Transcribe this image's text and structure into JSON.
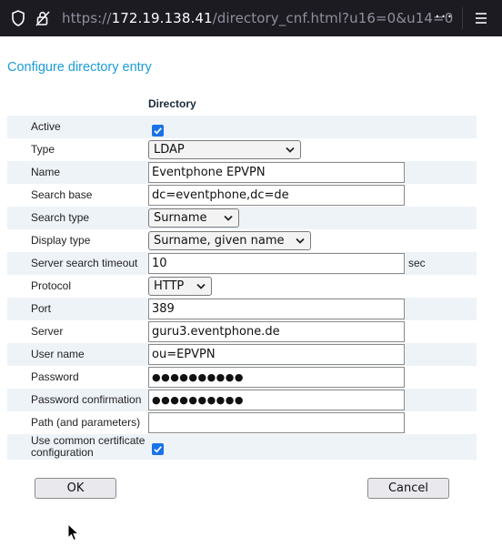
{
  "browser": {
    "url_prefix": "https://",
    "url_host": "172.19.138.41",
    "url_rest": "/directory_cnf.html?u16=0&u14=0",
    "menu_dots": "···"
  },
  "page": {
    "title": "Configure directory entry",
    "column_header": "Directory"
  },
  "form": {
    "active": {
      "label": "Active",
      "checked": true
    },
    "type": {
      "label": "Type",
      "value": "LDAP"
    },
    "name": {
      "label": "Name",
      "value": "Eventphone EPVPN"
    },
    "search_base": {
      "label": "Search base",
      "value": "dc=eventphone,dc=de"
    },
    "search_type": {
      "label": "Search type",
      "value": "Surname"
    },
    "display_type": {
      "label": "Display type",
      "value": "Surname, given name"
    },
    "server_search_timeout": {
      "label": "Server search timeout",
      "value": "10",
      "unit": "sec"
    },
    "protocol": {
      "label": "Protocol",
      "value": "HTTP"
    },
    "port": {
      "label": "Port",
      "value": "389"
    },
    "server": {
      "label": "Server",
      "value": "guru3.eventphone.de"
    },
    "user_name": {
      "label": "User name",
      "value": "ou=EPVPN"
    },
    "password": {
      "label": "Password",
      "value": "●●●●●●●●●●"
    },
    "password_confirmation": {
      "label": "Password confirmation",
      "value": "●●●●●●●●●●"
    },
    "path": {
      "label": "Path (and parameters)",
      "value": ""
    },
    "common_cert": {
      "label": "Use common certificate configuration",
      "checked": true
    }
  },
  "buttons": {
    "ok": "OK",
    "cancel": "Cancel"
  },
  "colors": {
    "title": "#1a9dd9",
    "row_alt": "#eef3f8",
    "checkbox": "#1a73e8",
    "toolbar": "#1c1b22"
  }
}
